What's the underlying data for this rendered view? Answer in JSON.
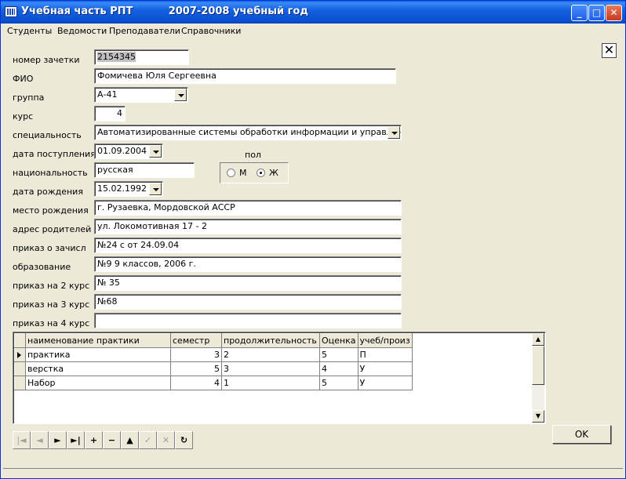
{
  "window": {
    "title": "Учебная часть РПТ          2007-2008 учебный год",
    "min": "_",
    "max": "□",
    "close": "✕"
  },
  "menu": [
    "Студенты",
    "Ведомости",
    "Преподаватели",
    "Справочники"
  ],
  "form_close": "✕",
  "fields": {
    "zachetka": {
      "label": "номер зачетки",
      "value": "2154345"
    },
    "fio": {
      "label": "ФИО",
      "value": "Фомичева Юля Сергеевна"
    },
    "gruppa": {
      "label": "группа",
      "value": "А-41"
    },
    "kurs": {
      "label": "курс",
      "value": "4"
    },
    "specialnost": {
      "label": "специальность",
      "value": "Автоматизированные системы обработки информации и управления"
    },
    "data_post": {
      "label": "дата поступления",
      "value": "01.09.2004"
    },
    "nacionalnost": {
      "label": "национальность",
      "value": "русская"
    },
    "data_rozhd": {
      "label": "дата рождения",
      "value": "15.02.1992"
    },
    "mesto_rozhd": {
      "label": "место рождения",
      "value": "г. Рузаевка, Мордовской АССР"
    },
    "adres": {
      "label": "адрес родителей",
      "value": "ул. Локомотивная 17 - 2"
    },
    "prikaz_zachisl": {
      "label": "приказ о зачисл",
      "value": "№24 с от 24.09.04"
    },
    "obrazovanie": {
      "label": "образование",
      "value": "№9 9 классов, 2006 г."
    },
    "prikaz2": {
      "label": "приказ на 2 курс",
      "value": "№ 35"
    },
    "prikaz3": {
      "label": "приказ на 3 курс",
      "value": "№68"
    },
    "prikaz4": {
      "label": "приказ на 4 курс",
      "value": ""
    }
  },
  "sex": {
    "label": "пол",
    "m": "М",
    "f": "Ж",
    "selected": "Ж"
  },
  "grid": {
    "columns": [
      "наименование практики",
      "семестр",
      "продолжительность",
      "Оценка",
      "учеб/произ"
    ],
    "rows": [
      [
        "практика",
        "3",
        "2",
        "5",
        "П"
      ],
      [
        "верстка",
        "5",
        "3",
        "4",
        "У"
      ],
      [
        "Набор",
        "4",
        "1",
        "5",
        "У"
      ]
    ]
  },
  "navigator": [
    {
      "name": "first-record-button",
      "glyph": "|◄",
      "enabled": false
    },
    {
      "name": "prior-record-button",
      "glyph": "◄",
      "enabled": false
    },
    {
      "name": "next-record-button",
      "glyph": "►",
      "enabled": true
    },
    {
      "name": "last-record-button",
      "glyph": "►|",
      "enabled": true
    },
    {
      "name": "insert-record-button",
      "glyph": "+",
      "enabled": true
    },
    {
      "name": "delete-record-button",
      "glyph": "−",
      "enabled": true
    },
    {
      "name": "edit-record-button",
      "glyph": "▲",
      "enabled": true
    },
    {
      "name": "post-record-button",
      "glyph": "✓",
      "enabled": false
    },
    {
      "name": "cancel-edit-button",
      "glyph": "✕",
      "enabled": false
    },
    {
      "name": "refresh-button",
      "glyph": "↻",
      "enabled": true
    }
  ],
  "ok_label": "OK"
}
